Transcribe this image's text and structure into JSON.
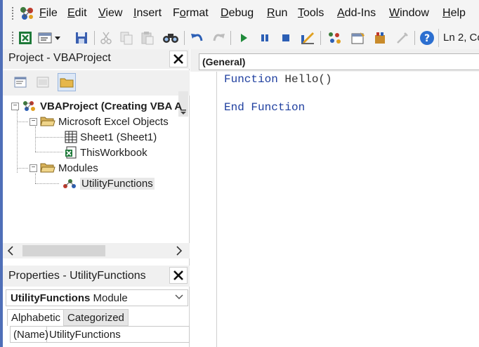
{
  "menubar": {
    "items": [
      "File",
      "Edit",
      "View",
      "Insert",
      "Format",
      "Debug",
      "Run",
      "Tools",
      "Add-Ins",
      "Window",
      "Help"
    ],
    "accel": [
      "F",
      "E",
      "V",
      "I",
      "o",
      "D",
      "R",
      "T",
      "A",
      "W",
      "H"
    ]
  },
  "toolbar": {
    "icons": [
      "excel-view-icon",
      "insert-userform-icon",
      "save-icon",
      "cut-icon",
      "copy-icon",
      "paste-icon",
      "find-icon",
      "undo-icon",
      "redo-icon",
      "run-icon",
      "break-icon",
      "reset-icon",
      "design-mode-icon",
      "project-explorer-icon",
      "properties-window-icon",
      "object-browser-icon",
      "toolbox-icon",
      "help-icon"
    ],
    "status": "Ln 2, Co"
  },
  "project": {
    "title": "Project - VBAProject",
    "tree": {
      "root": "VBAProject (Creating VBA A",
      "excel_objects": "Microsoft Excel Objects",
      "sheet1": "Sheet1 (Sheet1)",
      "workbook": "ThisWorkbook",
      "modules": "Modules",
      "module1": "UtilityFunctions"
    }
  },
  "properties": {
    "title": "Properties - UtilityFunctions",
    "object_name": "UtilityFunctions",
    "object_type": "Module",
    "tabs": [
      "Alphabetic",
      "Categorized"
    ],
    "row": {
      "name": "(Name)",
      "value": "UtilityFunctions"
    }
  },
  "code": {
    "object_box": "(General)",
    "lines": [
      {
        "keyword": "Function",
        "rest": " Hello()"
      },
      {
        "keyword": "End Function",
        "rest": ""
      }
    ]
  }
}
